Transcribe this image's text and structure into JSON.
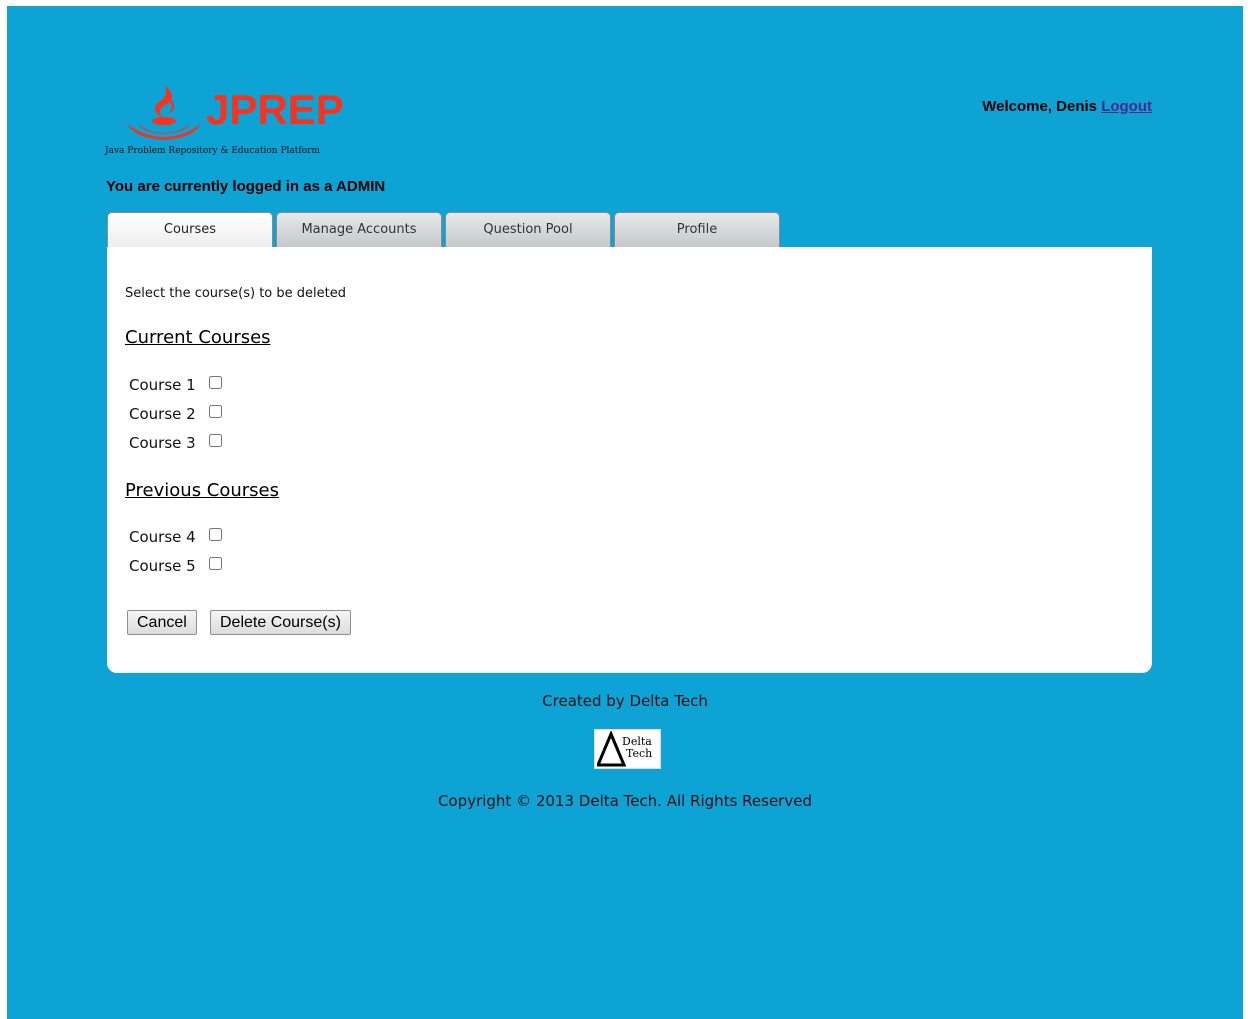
{
  "header": {
    "logo_text": "JPREP",
    "logo_tagline": "Java Problem Repository & Education Platform",
    "welcome_text": "Welcome, Denis",
    "logout_label": "Logout",
    "login_role_text": "You are currently logged in as a ADMIN"
  },
  "tabs": [
    {
      "label": "Courses",
      "active": true
    },
    {
      "label": "Manage Accounts",
      "active": false
    },
    {
      "label": "Question Pool",
      "active": false
    },
    {
      "label": "Profile",
      "active": false
    }
  ],
  "main": {
    "instruction": "Select the course(s) to be deleted",
    "current_title": "Current Courses",
    "current_courses": [
      {
        "label": "Course 1",
        "checked": false
      },
      {
        "label": "Course 2",
        "checked": false
      },
      {
        "label": "Course 3",
        "checked": false
      }
    ],
    "previous_title": "Previous Courses",
    "previous_courses": [
      {
        "label": "Course 4",
        "checked": false
      },
      {
        "label": "Course 5",
        "checked": false
      }
    ],
    "cancel_label": "Cancel",
    "delete_label": "Delete Course(s)"
  },
  "footer": {
    "created_by": "Created by Delta Tech",
    "delta_logo_line1": "Delta",
    "delta_logo_line2": "Tech",
    "copyright": "Copyright © 2013 Delta Tech. All Rights Reserved"
  },
  "colors": {
    "background": "#0ea3d5",
    "logo_red": "#f7321e",
    "logout_link": "#4b2a8f"
  }
}
